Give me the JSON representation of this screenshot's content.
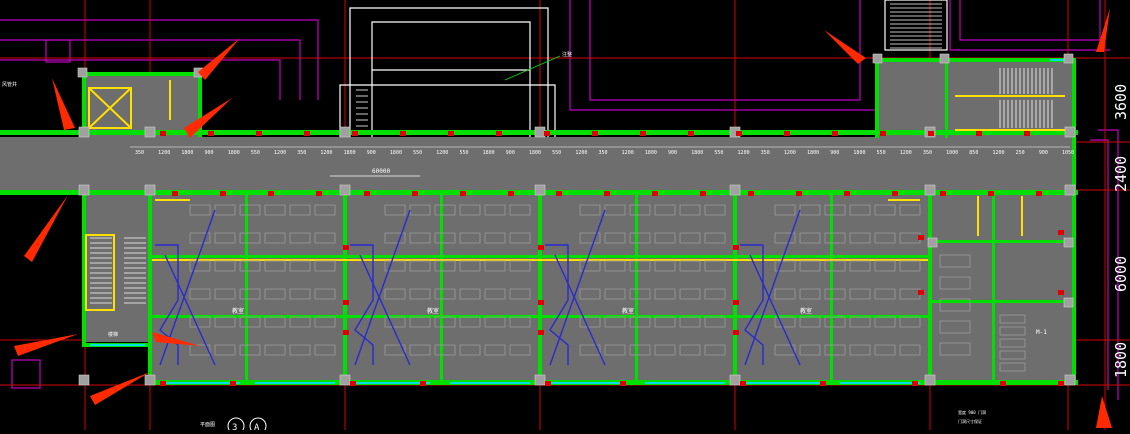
{
  "colors": {
    "background": "#000000",
    "wall": "#00e000",
    "floor": "#6e6e6e",
    "axis": "#d40000",
    "column": "#a0a0a0",
    "outline": "#c000c0",
    "text": "#ffffff",
    "dim_text": "#ffffff",
    "blue_lines": "#2a2ad0",
    "yellow": "#ffe000",
    "cyan": "#00e0e0",
    "arrow": "#ff2a00"
  },
  "corridor_dims": [
    "350",
    "1200",
    "1800",
    "900",
    "1800",
    "550",
    "1200",
    "350",
    "1200",
    "1800",
    "900",
    "1800",
    "550",
    "1200",
    "550",
    "1800",
    "900",
    "1800",
    "550",
    "1200",
    "350",
    "1200",
    "1800",
    "900",
    "1800",
    "550",
    "1200",
    "350",
    "1200",
    "1800",
    "900",
    "1800",
    "550",
    "1200",
    "350",
    "1000",
    "850",
    "1200",
    "250",
    "900",
    "1050"
  ],
  "corridor_total": "60000",
  "side_dims": [
    "3600",
    "2400",
    "6000",
    "1800"
  ],
  "room_labels": [
    "教室",
    "教室",
    "教室",
    "教室"
  ],
  "door_tag": "M-1",
  "misc_labels": {
    "left_tag": "风管井",
    "top_tag": "注整",
    "bottom_left": "平面图",
    "bottom_right_1": "宽度 900 门洞",
    "bottom_right_2": "门洞尺寸保证",
    "axis_a": "A",
    "axis_3": "3",
    "stair_tag": "楼梯"
  }
}
